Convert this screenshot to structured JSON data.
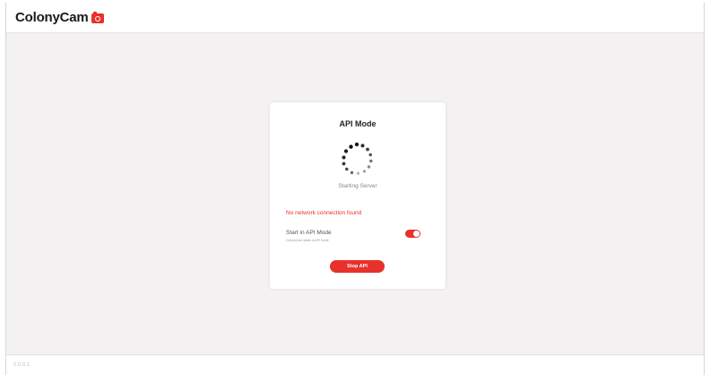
{
  "app": {
    "brand_name": "ColonyCam",
    "brand_icon": "camera-icon",
    "accent_color": "#e8312a"
  },
  "card": {
    "title": "API Mode",
    "spinner_icon": "loading-spinner-icon",
    "status_text": "Starting Server",
    "error_text": "No network connection found",
    "option_label": "Start in API Mode",
    "option_sublabel": "ColonyCam starts in API mode",
    "toggle_state": "on",
    "stop_button_label": "Stop API"
  },
  "footer": {
    "version": "0.0.0.1"
  }
}
